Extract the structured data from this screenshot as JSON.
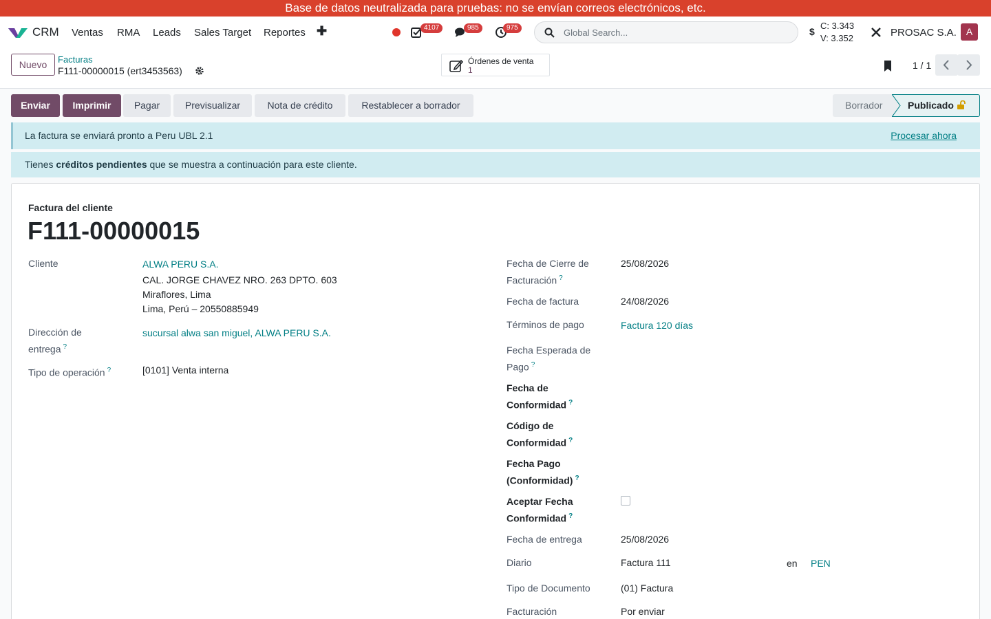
{
  "banner": "Base de datos neutralizada para pruebas: no se envían correos electrónicos, etc.",
  "nav": {
    "app": "CRM",
    "menus": [
      "Ventas",
      "RMA",
      "Leads",
      "Sales Target",
      "Reportes"
    ],
    "badges": {
      "activities": "4107",
      "messages": "985",
      "timers": "975"
    },
    "search_placeholder": "Global Search...",
    "rate_c": "C: 3.343",
    "rate_v": "V: 3.352",
    "company": "PROSAC S.A.",
    "avatar": "A"
  },
  "control": {
    "new_label": "Nuevo",
    "breadcrumb_parent": "Facturas",
    "breadcrumb_current": "F111-00000015 (ert3453563)",
    "smart_label": "Órdenes de venta",
    "smart_value": "1",
    "pager": "1 / 1"
  },
  "actions": [
    "Enviar",
    "Imprimir",
    "Pagar",
    "Previsualizar",
    "Nota de crédito",
    "Restablecer a borrador"
  ],
  "status": {
    "draft": "Borrador",
    "posted": "Publicado"
  },
  "alerts": {
    "ubl_text": "La factura se enviará pronto a Peru UBL 2.1",
    "ubl_link": "Procesar ahora",
    "credit_pre": "Tienes ",
    "credit_bold": "créditos pendientes",
    "credit_post": " que se muestra a continuación para este cliente."
  },
  "form": {
    "doc_type": "Factura del cliente",
    "doc_name": "F111-00000015",
    "left": {
      "cliente_label": "Cliente",
      "cliente_name": "ALWA PERU S.A.",
      "cliente_addr1": "CAL. JORGE CHAVEZ NRO. 263 DPTO. 603",
      "cliente_addr2": "Miraflores, Lima",
      "cliente_addr3": "Lima, Perú – 20550885949",
      "entrega_label_1": "Dirección de",
      "entrega_label_2": "entrega",
      "entrega_value": "sucursal alwa san miguel, ALWA PERU S.A.",
      "operacion_label": "Tipo de operación",
      "operacion_value": "[0101] Venta interna"
    },
    "right": {
      "cierre_label_1": "Fecha de Cierre de",
      "cierre_label_2": "Facturación",
      "cierre_value": "25/08/2026",
      "fecha_factura_label": "Fecha de factura",
      "fecha_factura_value": "24/08/2026",
      "terminos_label": "Términos de pago",
      "terminos_value": "Factura 120 días",
      "esperada_label_1": "Fecha Esperada de",
      "esperada_label_2": "Pago",
      "conf_fecha_label_1": "Fecha de",
      "conf_fecha_label_2": "Conformidad",
      "conf_codigo_label_1": "Código de",
      "conf_codigo_label_2": "Conformidad",
      "conf_pago_label_1": "Fecha Pago",
      "conf_pago_label_2": "(Conformidad)",
      "aceptar_label_1": "Aceptar Fecha",
      "aceptar_label_2": "Conformidad",
      "entrega_label": "Fecha de entrega",
      "entrega_value": "25/08/2026",
      "diario_label": "Diario",
      "diario_value": "Factura 111",
      "diario_en": "en",
      "diario_currency": "PEN",
      "tipo_doc_label": "Tipo de Documento",
      "tipo_doc_value": "(01) Factura",
      "facturacion_label": "Facturación",
      "facturacion_value": "Por enviar"
    },
    "help_mark": "?"
  },
  "colors": {
    "primary": "#714b67",
    "link": "#017e84",
    "banner": "#d9412c",
    "alert": "#d1ecf1"
  }
}
